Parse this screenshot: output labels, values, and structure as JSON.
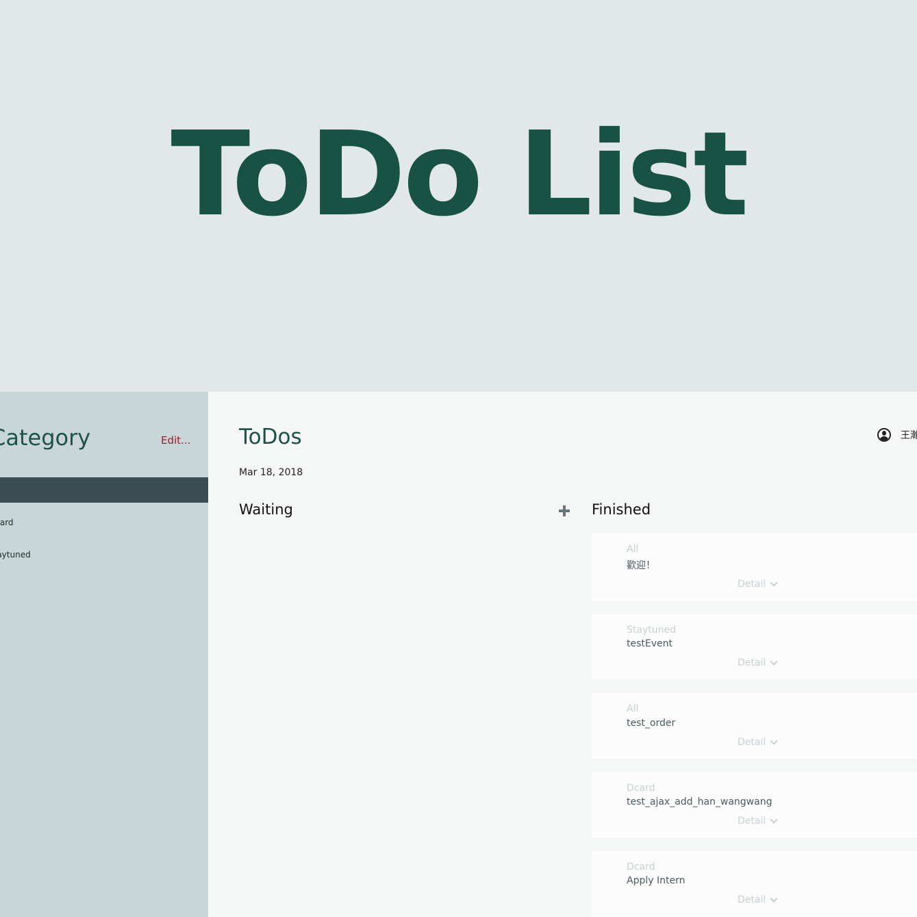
{
  "hero": {
    "title": "ToDo List"
  },
  "sidebar": {
    "title": "Category",
    "edit_label": "Edit...",
    "items": [
      {
        "label": "Dcard"
      },
      {
        "label": "Staytuned"
      }
    ]
  },
  "main": {
    "title": "ToDos",
    "date": "Mar 18, 2018",
    "user_name": "王瀚",
    "waiting_label": "Waiting",
    "finished_label": "Finished",
    "cards": [
      {
        "category": "All",
        "title": "歡迎！",
        "detail": "Detail"
      },
      {
        "category": "Staytuned",
        "title": "testEvent",
        "detail": "Detail"
      },
      {
        "category": "All",
        "title": "test_order",
        "detail": "Detail"
      },
      {
        "category": "Dcard",
        "title": "test_ajax_add_han_wangwang",
        "detail": "Detail"
      },
      {
        "category": "Dcard",
        "title": "Apply Intern",
        "detail": "Detail"
      }
    ]
  },
  "colors": {
    "brand_green": "#175245",
    "sidebar_bg": "#c9d6d7",
    "active_item": "#3b4c53",
    "edit_red": "#9a1b2b"
  }
}
